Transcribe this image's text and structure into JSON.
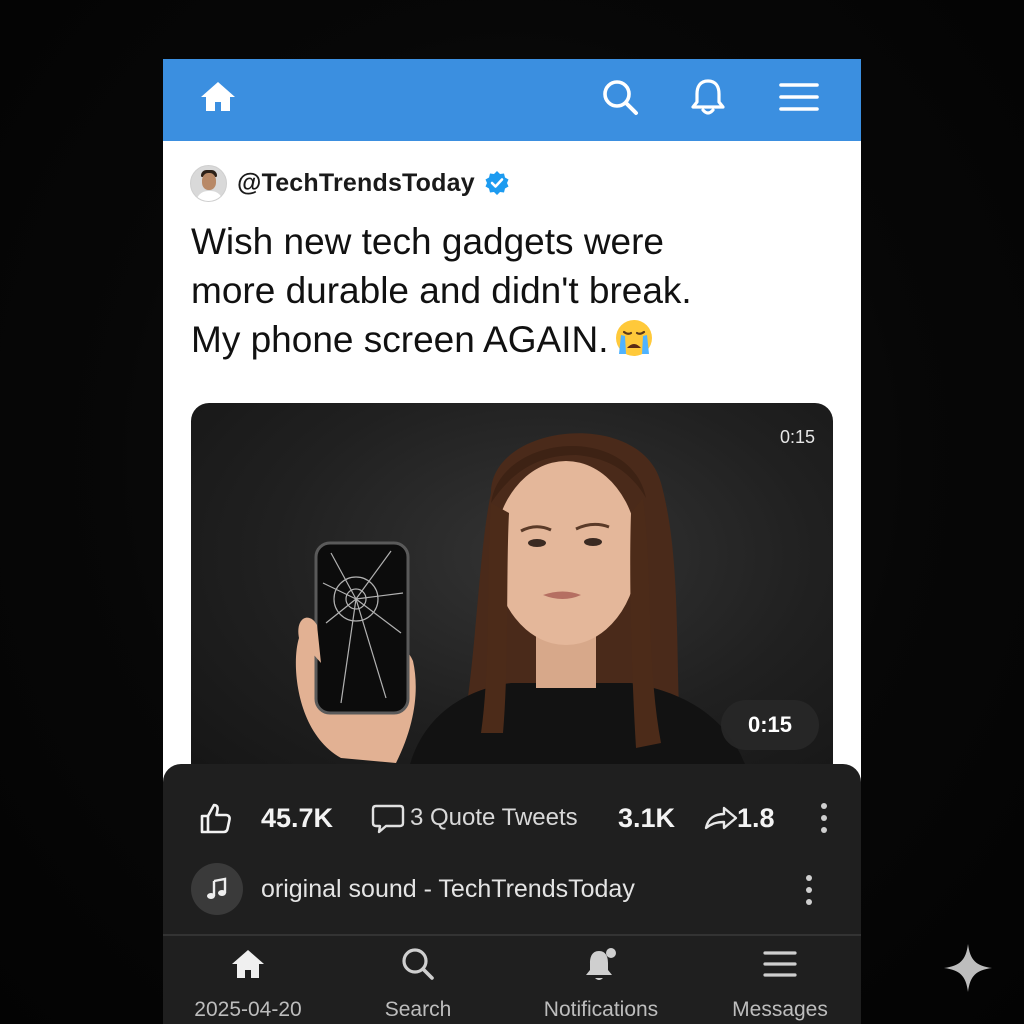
{
  "topbar": {
    "icons": [
      "home-icon",
      "search-icon",
      "bell-icon",
      "menu-icon"
    ],
    "color": "#3b8fe0"
  },
  "post": {
    "handle": "@TechTrendsToday",
    "verified": true,
    "text_lines": [
      "Wish new tech gadgets were",
      "more durable and didn't break.",
      "My phone screen AGAIN."
    ],
    "emoji": "crying-face-emoji",
    "video": {
      "duration_corner": "0:15",
      "duration_badge": "0:15"
    }
  },
  "stats": {
    "likes": "45.7K",
    "quote_tweets": "3 Quote Tweets",
    "retweets": "3.1K",
    "shares": "1.8"
  },
  "sound": {
    "label": "original sound - TechTrendsToday"
  },
  "bottom_nav": {
    "date": "2025-04-20",
    "search": "Search",
    "notifications": "Notifications",
    "messages": "Messages"
  },
  "colors": {
    "panel": "#1f1f1f",
    "verified": "#1d9bf0",
    "background": "#060606"
  }
}
